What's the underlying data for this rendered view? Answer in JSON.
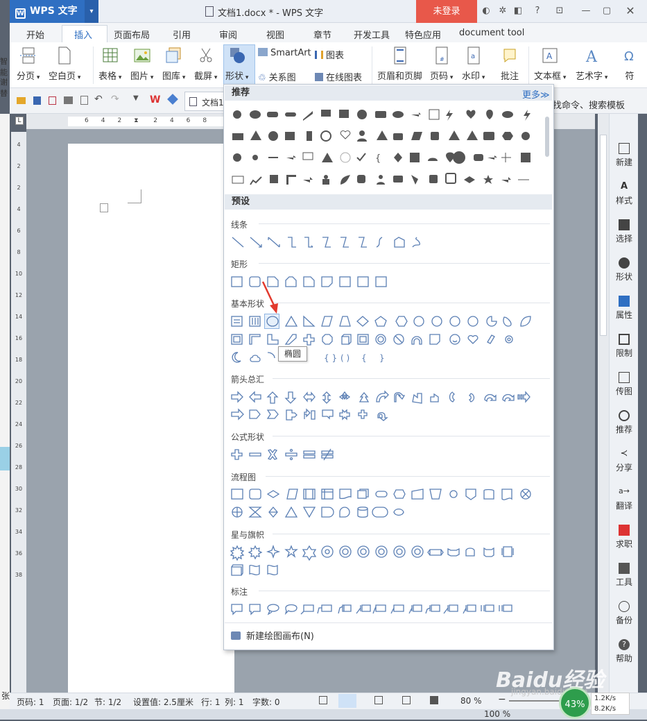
{
  "app": {
    "name": "WPS 文字",
    "document_title": "文档1.docx * - WPS 文字",
    "login_label": "未登录"
  },
  "menu": {
    "tabs": [
      "开始",
      "插入",
      "页面布局",
      "引用",
      "审阅",
      "视图",
      "章节",
      "开发工具",
      "特色应用",
      "document tool"
    ],
    "active": "插入"
  },
  "ribbon": {
    "page_break": "分页",
    "blank_page": "空白页",
    "table": "表格",
    "picture": "图片",
    "gallery": "图库",
    "screenshot": "截屏",
    "shapes": "形状",
    "smartart": "SmartArt",
    "chart": "图表",
    "relation_chart": "关系图",
    "online_chart": "在线图表",
    "header_footer": "页眉和页脚",
    "page_number": "页码",
    "watermark": "水印",
    "comment": "批注",
    "textbox": "文本框",
    "wordart": "艺术字",
    "symbol": "符"
  },
  "quickbar": {
    "doc_tab": "文档1",
    "search_hint": "查找命令、搜索模板"
  },
  "left_strip": {
    "top_label": "智能",
    "second_label": "谢替",
    "bottom_label": "张"
  },
  "ruler": {
    "h_ticks": [
      "6",
      "4",
      "2",
      "2",
      "4",
      "6",
      "8"
    ],
    "v_ticks": [
      "4",
      "2",
      "2",
      "4",
      "6",
      "8",
      "10",
      "12",
      "14",
      "16",
      "18",
      "20",
      "22",
      "24",
      "26",
      "28",
      "30",
      "32",
      "34",
      "36",
      "38"
    ]
  },
  "dropdown": {
    "recommend_header": "推荐",
    "more_link": "更多≫",
    "preset_header": "预设",
    "categories": {
      "lines": "线条",
      "rectangles": "矩形",
      "basic": "基本形状",
      "arrows": "箭头总汇",
      "equation": "公式形状",
      "flowchart": "流程图",
      "stars": "星与旗帜",
      "callouts": "标注"
    },
    "new_canvas": "新建绘图画布(N)",
    "tooltip": "椭圆"
  },
  "sidebar": {
    "items": [
      "新建",
      "样式",
      "选择",
      "形状",
      "属性",
      "限制",
      "传图",
      "推荐",
      "分享",
      "翻译",
      "求职",
      "工具",
      "备份",
      "帮助"
    ]
  },
  "status": {
    "page": "页码: 1",
    "pages": "页面: 1/2",
    "section": "节: 1/2",
    "setting": "设置值: 2.5厘米",
    "row": "行: 1",
    "col": "列: 1",
    "words": "字数: 0",
    "zoom": "80 %",
    "zoom2": "100 %"
  },
  "network": {
    "percent": "43%",
    "up": "1.2K/s",
    "down": "8.2K/s"
  },
  "watermark_text": {
    "main": "Baidu经验",
    "sub": "jingyan.baidu.com"
  },
  "colors": {
    "brand_blue": "#2f6fc2",
    "login_red": "#e8584a",
    "shape_fill": "#555555",
    "outline_blue": "#5b7fb4"
  }
}
